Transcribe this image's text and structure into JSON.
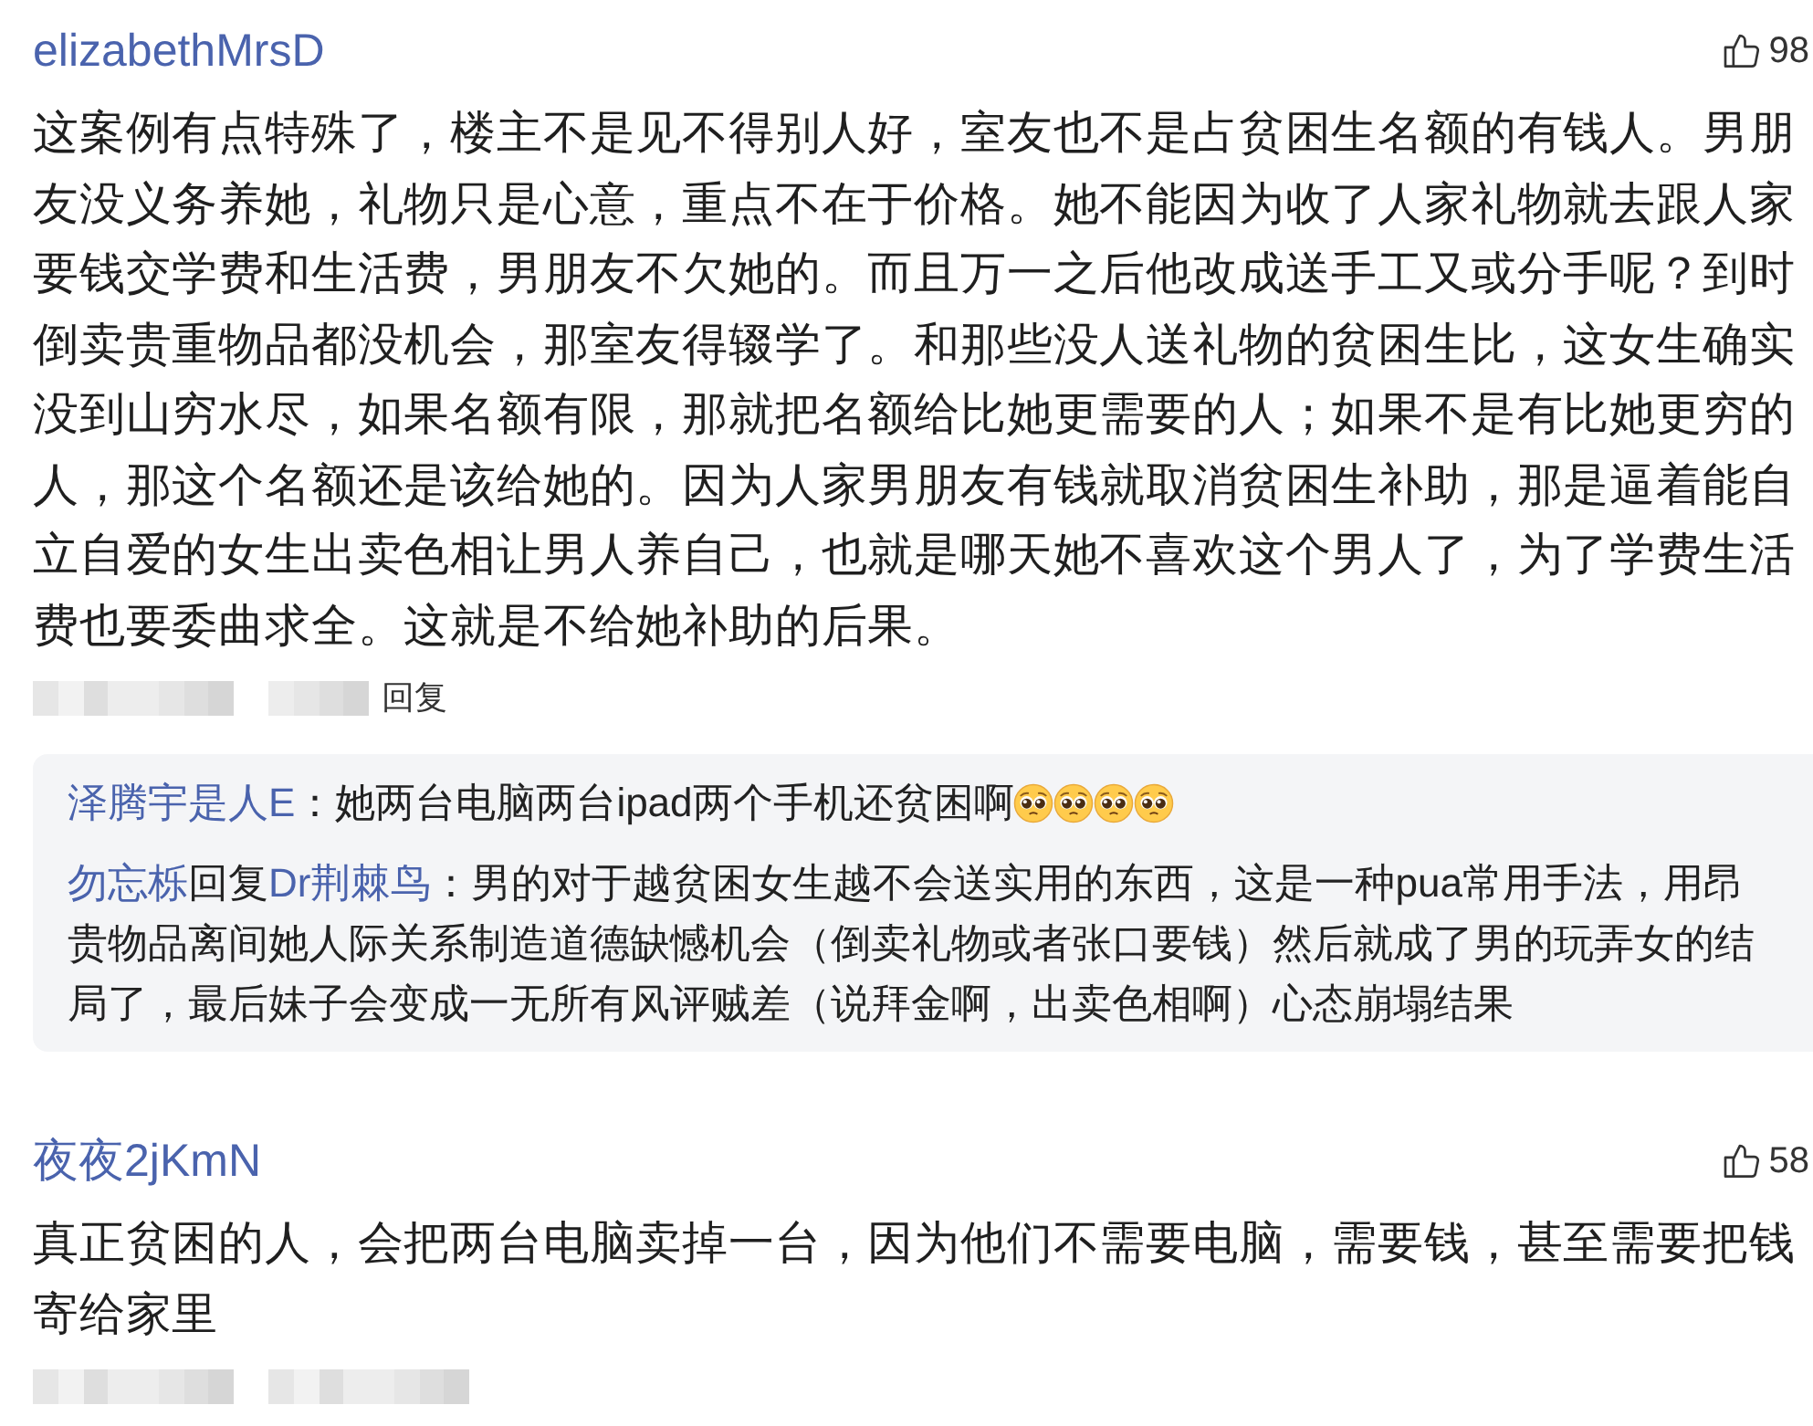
{
  "comments": [
    {
      "username": "elizabethMrsD",
      "likes": "98",
      "text": "这案例有点特殊了，楼主不是见不得别人好，室友也不是占贫困生名额的有钱人。男朋友没义务养她，礼物只是心意，重点不在于价格。她不能因为收了人家礼物就去跟人家要钱交学费和生活费，男朋友不欠她的。而且万一之后他改成送手工又或分手呢？到时倒卖贵重物品都没机会，那室友得辍学了。和那些没人送礼物的贫困生比，这女生确实没到山穷水尽，如果名额有限，那就把名额给比她更需要的人；如果不是有比她更穷的人，那这个名额还是该给她的。因为人家男朋友有钱就取消贫困生补助，那是逼着能自立自爱的女生出卖色相让男人养自己，也就是哪天她不喜欢这个男人了，为了学费生活费也要委曲求全。这就是不给她补助的后果。",
      "reply_action": "回复",
      "replies": [
        {
          "author": "泽腾宇是人E",
          "text": "：她两台电脑两台ipad两个手机还贫困啊",
          "emojis": [
            {
              "kind": "pleading"
            },
            {
              "kind": "pleading"
            },
            {
              "kind": "pleading"
            },
            {
              "kind": "pleading"
            }
          ]
        },
        {
          "author": "勿忘栎",
          "reply_word": "回复",
          "reply_to": "Dr荆棘鸟",
          "text": "：男的对于越贫困女生越不会送实用的东西，这是一种pua常用手法，用昂贵物品离间她人际关系制造道德缺憾机会（倒卖礼物或者张口要钱）然后就成了男的玩弄女的结局了，最后妹子会变成一无所有风评贼差（说拜金啊，出卖色相啊）心态崩塌结果"
        }
      ]
    },
    {
      "username": "夜夜2jKmN",
      "likes": "58",
      "text": "真正贫困的人，会把两台电脑卖掉一台，因为他们不需要电脑，需要钱，甚至需要把钱寄给家里"
    }
  ]
}
